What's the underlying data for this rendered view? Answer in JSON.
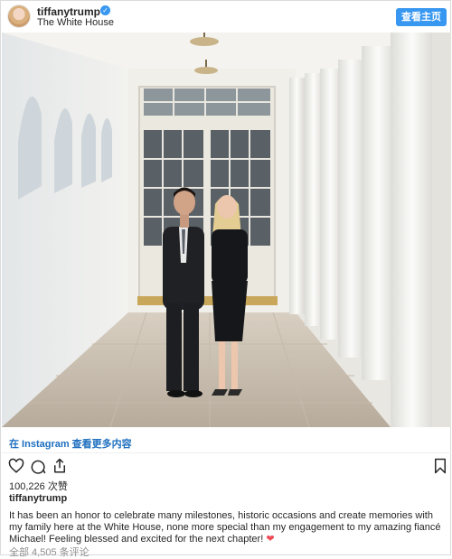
{
  "header": {
    "username": "tiffanytrump",
    "location": "The White House",
    "view_profile_label": "查看主页"
  },
  "photo": {
    "alt_description_icon": "post-photo"
  },
  "open_in_instagram_label": "在 Instagram 查看更多内容",
  "actions": {
    "like_icon": "heart-outline-icon",
    "comment_icon": "comment-icon",
    "share_icon": "share-icon",
    "save_icon": "bookmark-icon"
  },
  "likes_text": "100,226 次赞",
  "caption": {
    "username": "tiffanytrump",
    "text": "It has been an honor to celebrate many milestones, historic occasions and create memories with my family here at the White House, none more special than my engagement to my amazing fiancé Michael! Feeling blessed and excited for the next chapter!",
    "emoji": "❤"
  },
  "comments_text": "全部 4,505 条评论",
  "colors": {
    "primary_blue": "#3897f0",
    "link_blue": "#1e6fbf",
    "muted_text": "#8e8e8e",
    "heart_red": "#ed4956"
  }
}
